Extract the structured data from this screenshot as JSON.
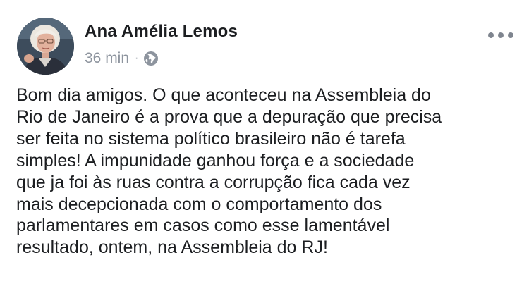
{
  "post": {
    "author": "Ana Amélia Lemos",
    "timestamp": "36 min",
    "separator": "·",
    "privacy_icon": "globe-icon",
    "menu_icon": "more-options-icon",
    "text_lines": [
      "Bom dia amigos. O que aconteceu na Assembleia do",
      "Rio de Janeiro é a prova que a depuração que precisa",
      "ser feita no sistema político brasileiro não é tarefa",
      "simples! A impunidade ganhou força e a sociedade",
      "que ja foi às ruas contra a corrupção fica cada vez",
      "mais decepcionada com o comportamento dos",
      "parlamentares em casos como esse lamentável",
      "resultado, ontem, na Assembleia do RJ!"
    ]
  },
  "colors": {
    "text": "#1c1e21",
    "meta": "#8d949e",
    "icon": "#7f858f"
  }
}
